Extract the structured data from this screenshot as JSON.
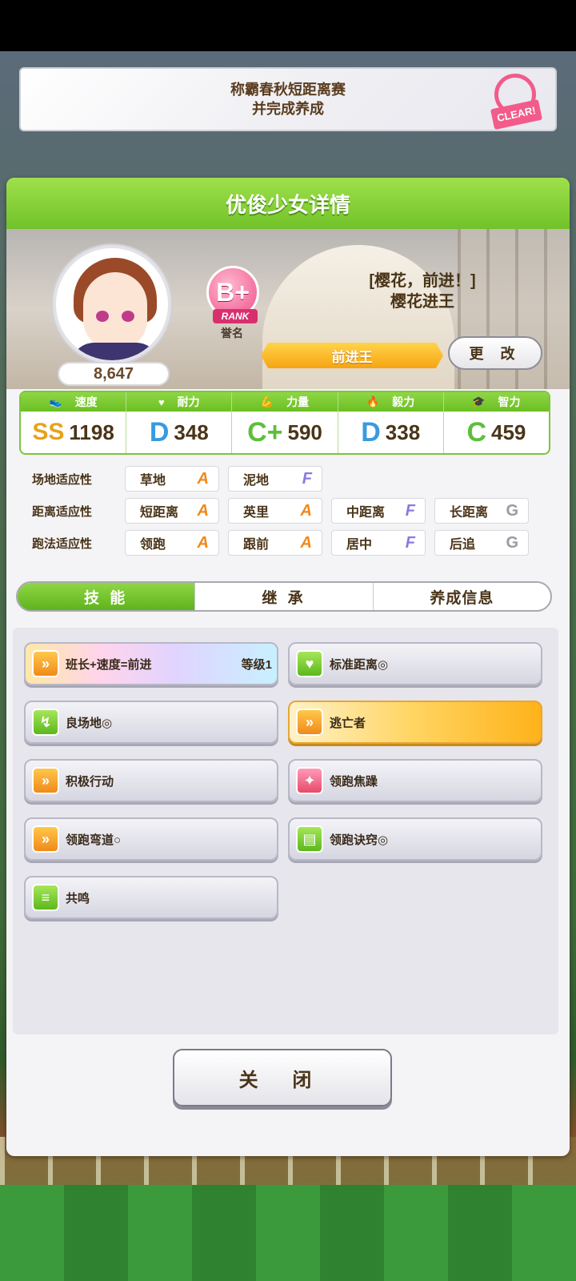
{
  "mission": {
    "line1": "称霸春秋短距离赛",
    "line2": "并完成养成",
    "stamp": "CLEAR!"
  },
  "panel": {
    "title": "优俊少女详情"
  },
  "character": {
    "score": "8,647",
    "rank": "B+",
    "rank_label": "RANK",
    "epithet_label": "誉名",
    "outfit": "[樱花，前进！]",
    "name": "樱花进王",
    "epithet": "前进王",
    "change_button": "更 改"
  },
  "stats": [
    {
      "label": "速度",
      "icon": "shoe-icon",
      "glyph": "👟",
      "grade": "SS",
      "grade_class": "grade-ss",
      "value": "1198"
    },
    {
      "label": "耐力",
      "icon": "heart-icon",
      "glyph": "♥",
      "grade": "D",
      "grade_class": "grade-d",
      "value": "348"
    },
    {
      "label": "力量",
      "icon": "muscle-icon",
      "glyph": "💪",
      "grade": "C+",
      "grade_class": "grade-c",
      "value": "590"
    },
    {
      "label": "毅力",
      "icon": "flame-icon",
      "glyph": "🔥",
      "grade": "D",
      "grade_class": "grade-d",
      "value": "338"
    },
    {
      "label": "智力",
      "icon": "graduation-cap-icon",
      "glyph": "🎓",
      "grade": "C",
      "grade_class": "grade-c",
      "value": "459"
    }
  ],
  "aptitude": {
    "track": {
      "label": "场地适应性",
      "items": [
        {
          "name": "草地",
          "grade": "A"
        },
        {
          "name": "泥地",
          "grade": "F"
        }
      ]
    },
    "distance": {
      "label": "距离适应性",
      "items": [
        {
          "name": "短距离",
          "grade": "A"
        },
        {
          "name": "英里",
          "grade": "A"
        },
        {
          "name": "中距离",
          "grade": "F"
        },
        {
          "name": "长距离",
          "grade": "G"
        }
      ]
    },
    "style": {
      "label": "跑法适应性",
      "items": [
        {
          "name": "领跑",
          "grade": "A"
        },
        {
          "name": "跟前",
          "grade": "A"
        },
        {
          "name": "居中",
          "grade": "F"
        },
        {
          "name": "后追",
          "grade": "G"
        }
      ]
    }
  },
  "tabs": [
    "技 能",
    "继 承",
    "养成信息"
  ],
  "skills": [
    {
      "name": "班长+速度=前进",
      "level": "等级1",
      "icon": "runner-icon",
      "color": "ic-orange",
      "style": "rainbow"
    },
    {
      "name": "标准距离◎",
      "icon": "heart-icon",
      "color": "ic-green",
      "style": ""
    },
    {
      "name": "良场地◎",
      "icon": "muscle-icon",
      "color": "ic-green",
      "style": ""
    },
    {
      "name": "逃亡者",
      "icon": "runner-icon",
      "color": "ic-orange",
      "style": "gold"
    },
    {
      "name": "积极行动",
      "icon": "runner-icon",
      "color": "ic-orange",
      "style": ""
    },
    {
      "name": "领跑焦躁",
      "icon": "sparkle-icon",
      "color": "ic-red",
      "style": ""
    },
    {
      "name": "领跑弯道○",
      "icon": "runner-icon",
      "color": "ic-orange",
      "style": ""
    },
    {
      "name": "领跑诀窍◎",
      "icon": "book-icon",
      "color": "ic-green",
      "style": ""
    },
    {
      "name": "共鸣",
      "icon": "card-icon",
      "color": "ic-green",
      "style": ""
    }
  ],
  "close_button": "关 闭"
}
